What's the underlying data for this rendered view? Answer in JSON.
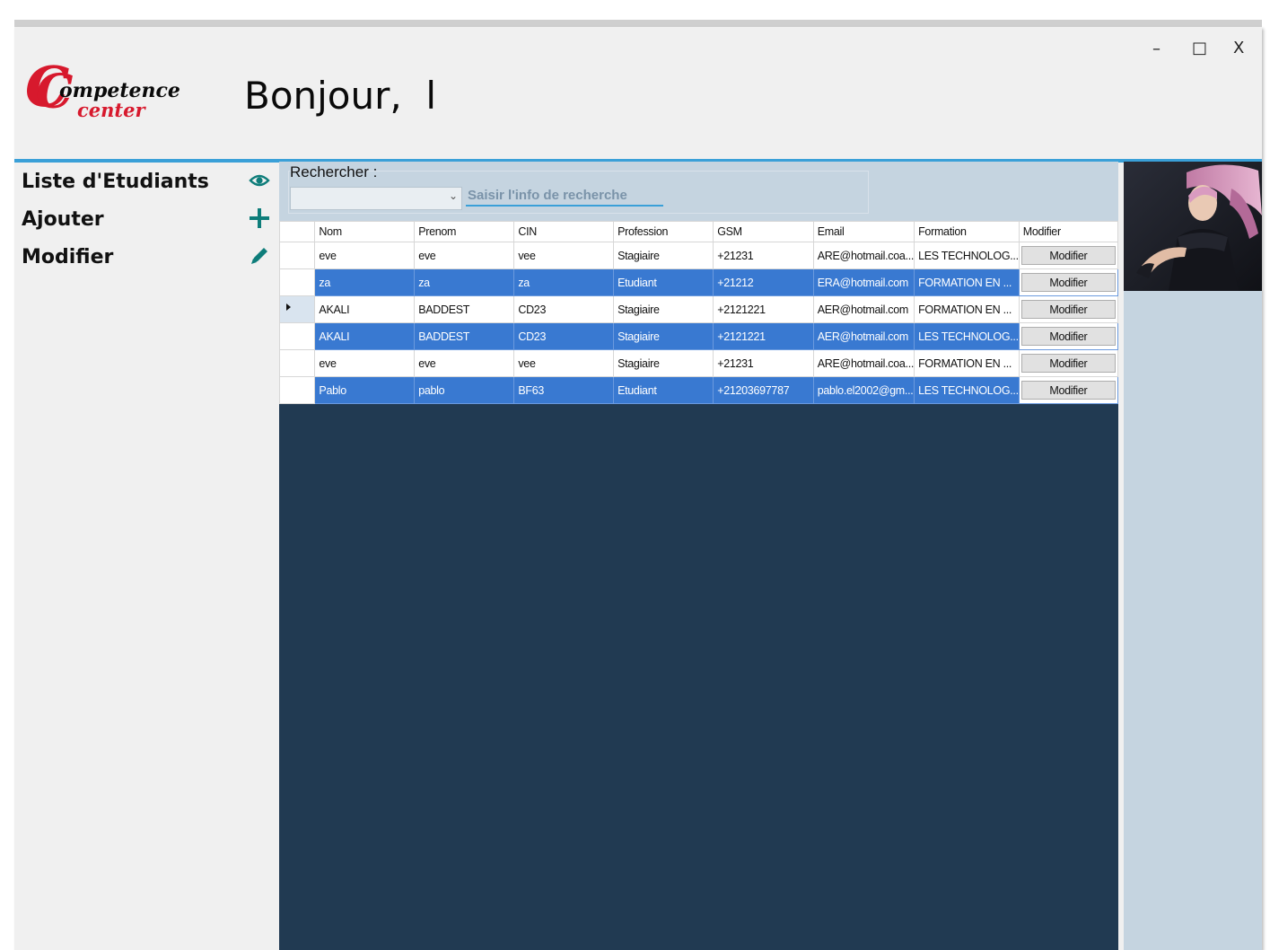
{
  "window": {
    "minimize": "–",
    "maximize": "□",
    "close": "X"
  },
  "logo": {
    "initial": "C",
    "word1": "ompetence",
    "word2": "center"
  },
  "header": {
    "greeting": "Bonjour,  l"
  },
  "sidebar": {
    "items": [
      {
        "label": "Liste  d'Etudiants",
        "icon": "eye-icon"
      },
      {
        "label": "Ajouter",
        "icon": "plus-icon"
      },
      {
        "label": "Modifier",
        "icon": "pencil-icon"
      }
    ]
  },
  "search": {
    "label": "Rechercher :",
    "combo_value": "",
    "placeholder": "Saisir l'info de recherche"
  },
  "table": {
    "columns": [
      "Nom",
      "Prenom",
      "CIN",
      "Profession",
      "GSM",
      "Email",
      "Formation",
      "Modifier"
    ],
    "rows": [
      {
        "nom": "eve",
        "prenom": "eve",
        "cin": "vee",
        "profession": "Stagiaire",
        "gsm": "+21231",
        "email": "ARE@hotmail.coa...",
        "formation": "LES TECHNOLOG...",
        "action": "Modifier",
        "selected": false,
        "current": false
      },
      {
        "nom": "za",
        "prenom": "za",
        "cin": "za",
        "profession": "Etudiant",
        "gsm": "+21212",
        "email": "ERA@hotmail.com",
        "formation": "FORMATION EN ...",
        "action": "Modifier",
        "selected": true,
        "current": false
      },
      {
        "nom": "AKALI",
        "prenom": "BADDEST",
        "cin": "CD23",
        "profession": "Stagiaire",
        "gsm": "+2121221",
        "email": "AER@hotmail.com",
        "formation": "FORMATION EN ...",
        "action": "Modifier",
        "selected": false,
        "current": true
      },
      {
        "nom": "AKALI",
        "prenom": "BADDEST",
        "cin": "CD23",
        "profession": "Stagiaire",
        "gsm": "+2121221",
        "email": "AER@hotmail.com",
        "formation": "LES TECHNOLOG...",
        "action": "Modifier",
        "selected": true,
        "current": false
      },
      {
        "nom": "eve",
        "prenom": "eve",
        "cin": "vee",
        "profession": "Stagiaire",
        "gsm": "+21231",
        "email": "ARE@hotmail.coa...",
        "formation": "FORMATION EN ...",
        "action": "Modifier",
        "selected": false,
        "current": false
      },
      {
        "nom": "Pablo",
        "prenom": "pablo",
        "cin": "BF63",
        "profession": "Etudiant",
        "gsm": "+21203697787",
        "email": "pablo.el2002@gm...",
        "formation": "LES TECHNOLOG...",
        "action": "Modifier",
        "selected": true,
        "current": false
      }
    ]
  },
  "colors": {
    "accent": "#3aa0d8",
    "brand_red": "#d7192d",
    "selection": "#3979d1",
    "grid_background": "#213a52",
    "panel": "#c5d4e0",
    "icon_teal": "#0e7d7a"
  }
}
